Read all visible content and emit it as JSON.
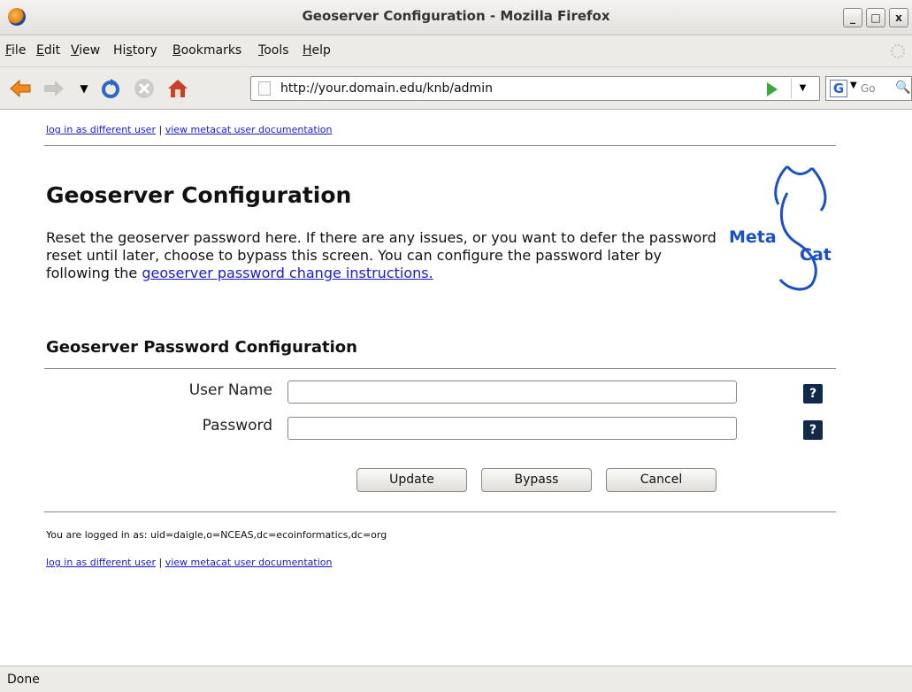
{
  "window": {
    "title": "Geoserver Configuration - Mozilla Firefox",
    "controls": {
      "minimize": "_",
      "maximize": "□",
      "close": "x"
    }
  },
  "menubar": {
    "items": [
      {
        "label": "File",
        "key": "F"
      },
      {
        "label": "Edit",
        "key": "E"
      },
      {
        "label": "View",
        "key": "V"
      },
      {
        "label": "History",
        "key": "s"
      },
      {
        "label": "Bookmarks",
        "key": "B"
      },
      {
        "label": "Tools",
        "key": "T"
      },
      {
        "label": "Help",
        "key": "H"
      }
    ]
  },
  "navbar": {
    "url": "http://your.domain.edu/knb/admin",
    "search_placeholder": "Go",
    "search_engine_letter": "G",
    "icons": [
      "back-arrow-icon",
      "forward-arrow-icon",
      "history-dropdown-icon",
      "reload-icon",
      "stop-icon",
      "home-icon"
    ]
  },
  "page": {
    "top_links": {
      "login": "log in as different user",
      "separator": "|",
      "docs": "view metacat user documentation"
    },
    "title": "Geoserver Configuration",
    "intro_text": "Reset the geoserver password here. If there are any issues, or you want to defer the password reset until later, choose to bypass this screen. You can configure the password later by following the ",
    "intro_link": "geoserver password change instructions.",
    "logo": {
      "line1": "Meta",
      "line2": "Cat",
      "color": "#1b4fc4"
    },
    "section_title": "Geoserver Password Configuration",
    "form": {
      "username_label": "User Name",
      "username_value": "",
      "password_label": "Password",
      "password_value": "",
      "help_label": "?"
    },
    "buttons": {
      "update": "Update",
      "bypass": "Bypass",
      "cancel": "Cancel"
    },
    "logged_in_text": "You are logged in as: uid=daigle,o=NCEAS,dc=ecoinformatics,dc=org",
    "footer_links": {
      "login": "log in as different user",
      "separator": "|",
      "docs": "view metacat user documentation"
    }
  },
  "statusbar": {
    "text": "Done"
  },
  "colors": {
    "link": "#1a1ad4",
    "help_button": "#13294a",
    "chrome": "#edebe7"
  }
}
